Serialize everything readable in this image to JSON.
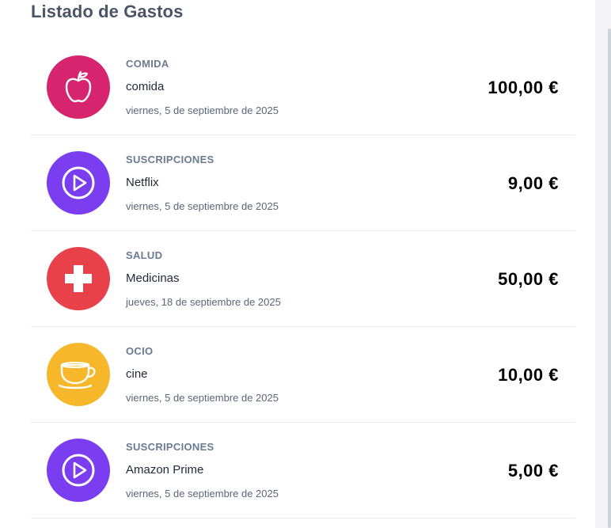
{
  "header": {
    "title": "Listado de Gastos"
  },
  "expenses": [
    {
      "category": "COMIDA",
      "description": "comida",
      "date": "viernes, 5 de septiembre de 2025",
      "amount": "100,00 €",
      "icon": "apple-icon",
      "color": "#d6246e"
    },
    {
      "category": "SUSCRIPCIONES",
      "description": "Netflix",
      "date": "viernes, 5 de septiembre de 2025",
      "amount": "9,00 €",
      "icon": "play-circle-icon",
      "color": "#7b3df0"
    },
    {
      "category": "SALUD",
      "description": "Medicinas",
      "date": "jueves, 18 de septiembre de 2025",
      "amount": "50,00 €",
      "icon": "medical-cross-icon",
      "color": "#e8414a"
    },
    {
      "category": "OCIO",
      "description": "cine",
      "date": "viernes, 5 de septiembre de 2025",
      "amount": "10,00 €",
      "icon": "cup-icon",
      "color": "#f6b82a"
    },
    {
      "category": "SUSCRIPCIONES",
      "description": "Amazon Prime",
      "date": "viernes, 5 de septiembre de 2025",
      "amount": "5,00 €",
      "icon": "play-circle-icon",
      "color": "#7b3df0"
    }
  ]
}
